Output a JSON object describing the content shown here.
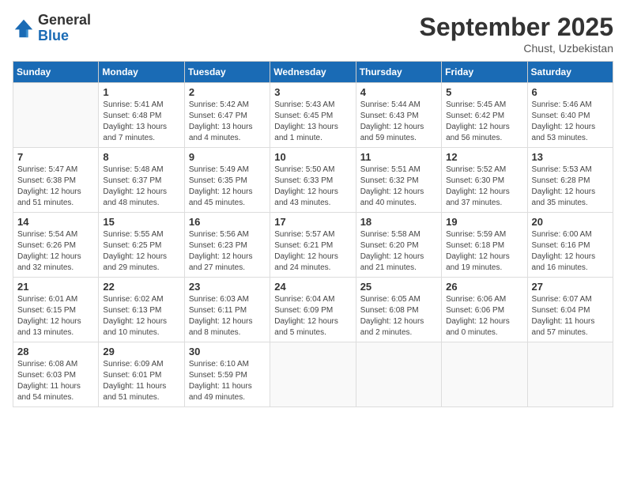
{
  "header": {
    "logo_general": "General",
    "logo_blue": "Blue",
    "month_title": "September 2025",
    "subtitle": "Chust, Uzbekistan"
  },
  "days_of_week": [
    "Sunday",
    "Monday",
    "Tuesday",
    "Wednesday",
    "Thursday",
    "Friday",
    "Saturday"
  ],
  "weeks": [
    [
      {
        "day": "",
        "info": ""
      },
      {
        "day": "1",
        "info": "Sunrise: 5:41 AM\nSunset: 6:48 PM\nDaylight: 13 hours\nand 7 minutes."
      },
      {
        "day": "2",
        "info": "Sunrise: 5:42 AM\nSunset: 6:47 PM\nDaylight: 13 hours\nand 4 minutes."
      },
      {
        "day": "3",
        "info": "Sunrise: 5:43 AM\nSunset: 6:45 PM\nDaylight: 13 hours\nand 1 minute."
      },
      {
        "day": "4",
        "info": "Sunrise: 5:44 AM\nSunset: 6:43 PM\nDaylight: 12 hours\nand 59 minutes."
      },
      {
        "day": "5",
        "info": "Sunrise: 5:45 AM\nSunset: 6:42 PM\nDaylight: 12 hours\nand 56 minutes."
      },
      {
        "day": "6",
        "info": "Sunrise: 5:46 AM\nSunset: 6:40 PM\nDaylight: 12 hours\nand 53 minutes."
      }
    ],
    [
      {
        "day": "7",
        "info": "Sunrise: 5:47 AM\nSunset: 6:38 PM\nDaylight: 12 hours\nand 51 minutes."
      },
      {
        "day": "8",
        "info": "Sunrise: 5:48 AM\nSunset: 6:37 PM\nDaylight: 12 hours\nand 48 minutes."
      },
      {
        "day": "9",
        "info": "Sunrise: 5:49 AM\nSunset: 6:35 PM\nDaylight: 12 hours\nand 45 minutes."
      },
      {
        "day": "10",
        "info": "Sunrise: 5:50 AM\nSunset: 6:33 PM\nDaylight: 12 hours\nand 43 minutes."
      },
      {
        "day": "11",
        "info": "Sunrise: 5:51 AM\nSunset: 6:32 PM\nDaylight: 12 hours\nand 40 minutes."
      },
      {
        "day": "12",
        "info": "Sunrise: 5:52 AM\nSunset: 6:30 PM\nDaylight: 12 hours\nand 37 minutes."
      },
      {
        "day": "13",
        "info": "Sunrise: 5:53 AM\nSunset: 6:28 PM\nDaylight: 12 hours\nand 35 minutes."
      }
    ],
    [
      {
        "day": "14",
        "info": "Sunrise: 5:54 AM\nSunset: 6:26 PM\nDaylight: 12 hours\nand 32 minutes."
      },
      {
        "day": "15",
        "info": "Sunrise: 5:55 AM\nSunset: 6:25 PM\nDaylight: 12 hours\nand 29 minutes."
      },
      {
        "day": "16",
        "info": "Sunrise: 5:56 AM\nSunset: 6:23 PM\nDaylight: 12 hours\nand 27 minutes."
      },
      {
        "day": "17",
        "info": "Sunrise: 5:57 AM\nSunset: 6:21 PM\nDaylight: 12 hours\nand 24 minutes."
      },
      {
        "day": "18",
        "info": "Sunrise: 5:58 AM\nSunset: 6:20 PM\nDaylight: 12 hours\nand 21 minutes."
      },
      {
        "day": "19",
        "info": "Sunrise: 5:59 AM\nSunset: 6:18 PM\nDaylight: 12 hours\nand 19 minutes."
      },
      {
        "day": "20",
        "info": "Sunrise: 6:00 AM\nSunset: 6:16 PM\nDaylight: 12 hours\nand 16 minutes."
      }
    ],
    [
      {
        "day": "21",
        "info": "Sunrise: 6:01 AM\nSunset: 6:15 PM\nDaylight: 12 hours\nand 13 minutes."
      },
      {
        "day": "22",
        "info": "Sunrise: 6:02 AM\nSunset: 6:13 PM\nDaylight: 12 hours\nand 10 minutes."
      },
      {
        "day": "23",
        "info": "Sunrise: 6:03 AM\nSunset: 6:11 PM\nDaylight: 12 hours\nand 8 minutes."
      },
      {
        "day": "24",
        "info": "Sunrise: 6:04 AM\nSunset: 6:09 PM\nDaylight: 12 hours\nand 5 minutes."
      },
      {
        "day": "25",
        "info": "Sunrise: 6:05 AM\nSunset: 6:08 PM\nDaylight: 12 hours\nand 2 minutes."
      },
      {
        "day": "26",
        "info": "Sunrise: 6:06 AM\nSunset: 6:06 PM\nDaylight: 12 hours\nand 0 minutes."
      },
      {
        "day": "27",
        "info": "Sunrise: 6:07 AM\nSunset: 6:04 PM\nDaylight: 11 hours\nand 57 minutes."
      }
    ],
    [
      {
        "day": "28",
        "info": "Sunrise: 6:08 AM\nSunset: 6:03 PM\nDaylight: 11 hours\nand 54 minutes."
      },
      {
        "day": "29",
        "info": "Sunrise: 6:09 AM\nSunset: 6:01 PM\nDaylight: 11 hours\nand 51 minutes."
      },
      {
        "day": "30",
        "info": "Sunrise: 6:10 AM\nSunset: 5:59 PM\nDaylight: 11 hours\nand 49 minutes."
      },
      {
        "day": "",
        "info": ""
      },
      {
        "day": "",
        "info": ""
      },
      {
        "day": "",
        "info": ""
      },
      {
        "day": "",
        "info": ""
      }
    ]
  ]
}
